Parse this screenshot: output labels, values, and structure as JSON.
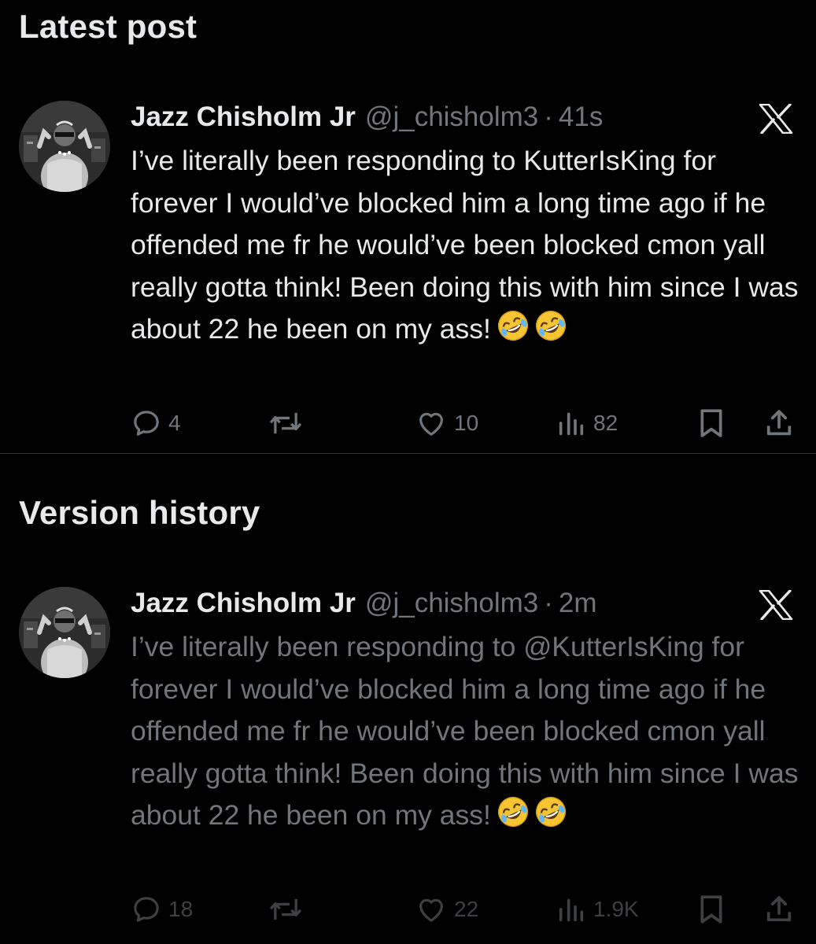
{
  "sections": {
    "latest_title": "Latest post",
    "history_title": "Version history"
  },
  "latest_post": {
    "author_name": "Jazz Chisholm Jr",
    "handle": "@j_chisholm3",
    "separator": "·",
    "time": "41s",
    "text": "I’ve literally been responding to KutterIsKing for forever I would’ve blocked him a long time ago if he offended me fr he would’ve been blocked cmon yall really gotta think! Been doing this with him since I was about 22 he been on my ass!",
    "emojis": [
      "rolling-on-floor-laughing",
      "rolling-on-floor-laughing"
    ],
    "replies": "4",
    "reposts": "",
    "likes": "10",
    "views": "82"
  },
  "history_post": {
    "author_name": "Jazz Chisholm Jr",
    "handle": "@j_chisholm3",
    "separator": "·",
    "time": "2m",
    "text": "I’ve literally been responding to @KutterIsKing for forever I would’ve blocked him a long time ago if he offended me fr he would’ve been blocked cmon yall really gotta think! Been doing this with him since I was about 22 he been on my ass!",
    "emojis": [
      "rolling-on-floor-laughing",
      "rolling-on-floor-laughing"
    ],
    "replies": "18",
    "reposts": "",
    "likes": "22",
    "views": "1.9K"
  },
  "icons": {
    "platform": "x-logo",
    "reply": "speech-bubble-icon",
    "repost": "repost-arrows-icon",
    "like": "heart-icon",
    "views": "bar-chart-icon",
    "bookmark": "bookmark-icon",
    "share": "share-upload-icon"
  },
  "colors": {
    "background": "#000000",
    "primary_text": "#e7e9ea",
    "secondary_text": "#71767b",
    "divider": "#2f3336"
  }
}
